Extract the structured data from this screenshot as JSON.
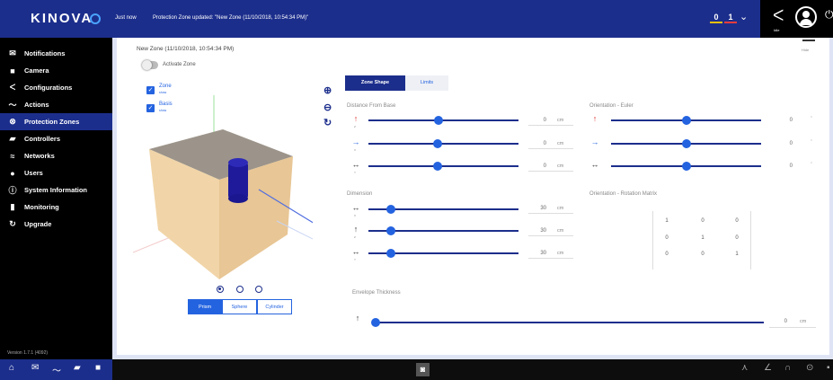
{
  "topbar": {
    "logo": "KINOVA",
    "notification_time": "Just now",
    "notification_message": "Protection Zone updated: \"New Zone (11/10/2018, 10:54:34 PM)\"",
    "counter_warnings": "0",
    "counter_errors": "1",
    "controller_label": "Idle"
  },
  "sidebar": {
    "items": [
      {
        "label": "Notifications",
        "icon": "bell-icon"
      },
      {
        "label": "Camera",
        "icon": "camera-icon"
      },
      {
        "label": "Configurations",
        "icon": "wrench-icon"
      },
      {
        "label": "Actions",
        "icon": "actions-icon"
      },
      {
        "label": "Protection Zones",
        "icon": "shield-icon",
        "active": true
      },
      {
        "label": "Controllers",
        "icon": "gamepad-icon"
      },
      {
        "label": "Networks",
        "icon": "wifi-icon"
      },
      {
        "label": "Users",
        "icon": "user-icon"
      },
      {
        "label": "System Information",
        "icon": "info-icon"
      },
      {
        "label": "Monitoring",
        "icon": "bar-chart-icon"
      },
      {
        "label": "Upgrade",
        "icon": "upgrade-icon"
      }
    ],
    "version": "Version 1.7.1 (4092)"
  },
  "zone": {
    "title": "New Zone (11/10/2018, 10:54:34 PM)",
    "hide_label": "Hide",
    "activate_label": "Activate Zone",
    "checkboxes": [
      {
        "label": "Zone",
        "sub": "show"
      },
      {
        "label": "Basis",
        "sub": "show"
      }
    ],
    "shape_buttons": [
      "Prism",
      "Sphere",
      "Cylinder"
    ],
    "selected_shape": "Prism"
  },
  "tabs": {
    "zone_shape": "Zone Shape",
    "limits": "Limits"
  },
  "distance_from_base": {
    "label": "Distance From Base",
    "rows": [
      {
        "axis": "Z",
        "value": "0",
        "unit": "cm",
        "level": 0.47
      },
      {
        "axis": "X",
        "value": "0",
        "unit": "cm",
        "level": 0.46
      },
      {
        "axis": "Y",
        "value": "0",
        "unit": "cm",
        "level": 0.46
      }
    ]
  },
  "orientation_euler": {
    "label": "Orientation - Euler",
    "rows": [
      {
        "axis": "Z",
        "value": "0",
        "level": 0.5
      },
      {
        "axis": "X",
        "value": "0",
        "level": 0.5
      },
      {
        "axis": "Y",
        "value": "0",
        "level": 0.5
      }
    ]
  },
  "dimension": {
    "label": "Dimension",
    "rows": [
      {
        "axis": "X",
        "value": "30",
        "unit": "cm",
        "level": 0.15
      },
      {
        "axis": "Z",
        "value": "30",
        "unit": "cm",
        "level": 0.15
      },
      {
        "axis": "Y",
        "value": "30",
        "unit": "cm",
        "level": 0.15
      }
    ]
  },
  "orientation_matrix": {
    "label": "Orientation - Rotation Matrix",
    "values": [
      [
        "1",
        "0",
        "0"
      ],
      [
        "0",
        "1",
        "0"
      ],
      [
        "0",
        "0",
        "1"
      ]
    ]
  },
  "envelope": {
    "label": "Envelope Thickness",
    "value": "0",
    "unit": "cm",
    "level": 0.0
  },
  "colors": {
    "brand": "#1c2e8c",
    "accent": "#2463e0",
    "box_top": "#9c948a",
    "box_side": "#e8c695"
  }
}
